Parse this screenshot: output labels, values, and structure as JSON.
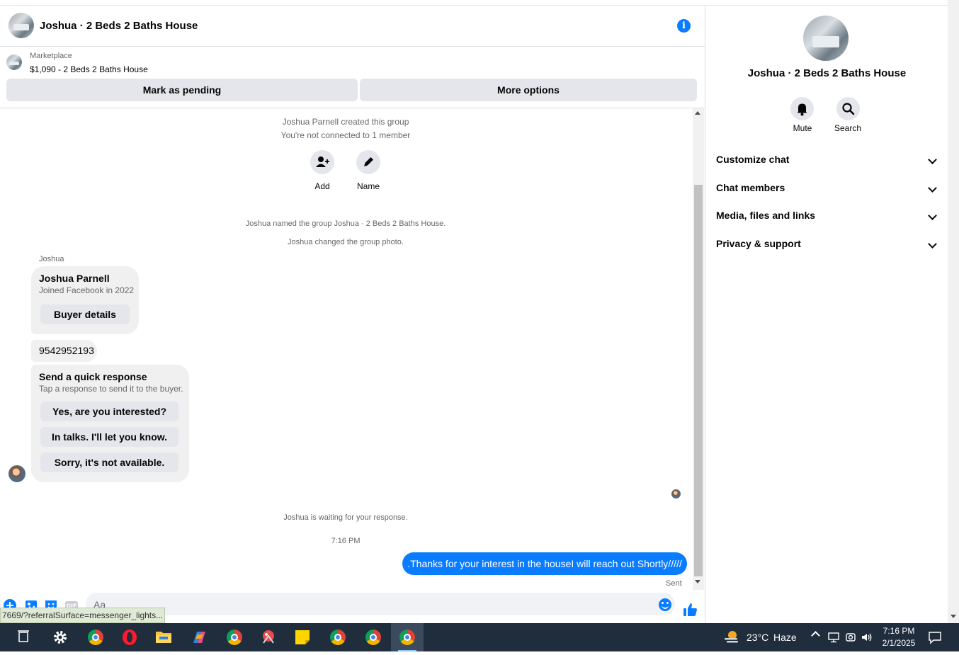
{
  "header": {
    "title": "Joshua · 2 Beds 2 Baths House",
    "info_icon": "info-icon"
  },
  "marketplace": {
    "label": "Marketplace",
    "listing": "$1,090 - 2 Beds 2 Baths House"
  },
  "actions": {
    "mark_pending": "Mark as pending",
    "more_options": "More options"
  },
  "thread": {
    "created": "Joshua Parnell created this group",
    "not_connected": "You're not connected to 1 member",
    "add_label": "Add",
    "name_label": "Name",
    "named_group": "Joshua named the group Joshua · 2 Beds 2 Baths House.",
    "changed_photo": "Joshua changed the group photo.",
    "sender": "Joshua",
    "profile_card": {
      "name": "Joshua Parnell",
      "joined": "Joined Facebook in 2022",
      "button": "Buyer details"
    },
    "phone": "9542952193",
    "quick_response": {
      "title": "Send a quick response",
      "subtitle": "Tap a response to send it to the buyer.",
      "options": [
        "Yes, are you interested?",
        "In talks. I'll let you know.",
        "Sorry, it's not available."
      ]
    },
    "waiting": "Joshua is waiting for your response.",
    "time": "7:16 PM",
    "my_message": ".Thanks for your interest in the houseI will reach out Shortly/////",
    "sent_status": "Sent"
  },
  "composer": {
    "placeholder": "Aa"
  },
  "status_url": "7669/?referralSurface=messenger_lights...",
  "sidebar": {
    "title": "Joshua · 2 Beds 2 Baths House",
    "mute_label": "Mute",
    "search_label": "Search",
    "sections": [
      "Customize chat",
      "Chat members",
      "Media, files and links",
      "Privacy & support"
    ]
  },
  "taskbar": {
    "weather_temp": "23°C",
    "weather_desc": "Haze",
    "time": "7:16 PM",
    "date": "2/1/2025"
  },
  "colors": {
    "accent": "#0a7cff",
    "bubble_gray": "#f0f0f0",
    "button_gray": "#e4e6eb",
    "taskbar": "#1f2d3d"
  }
}
